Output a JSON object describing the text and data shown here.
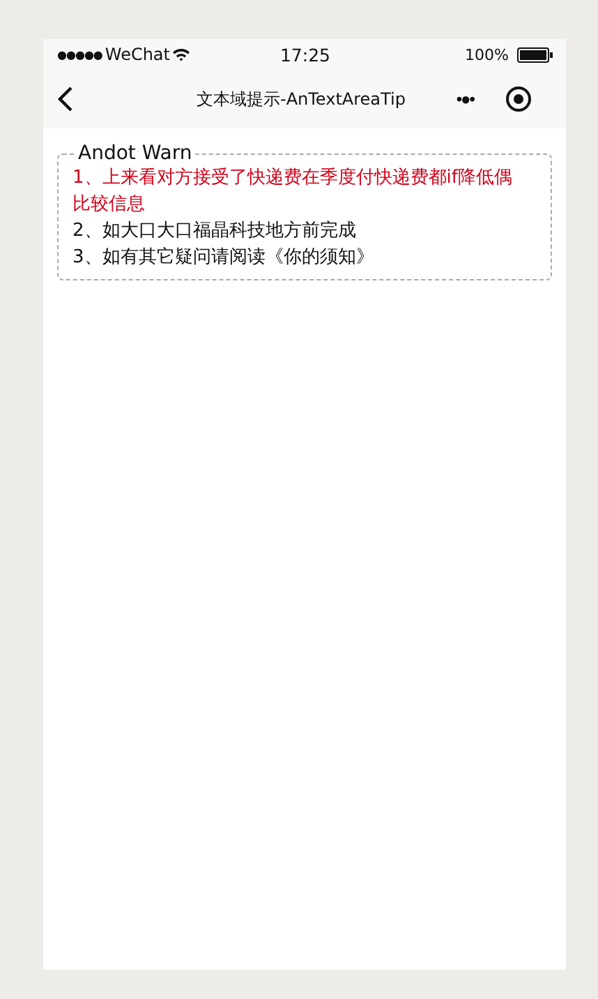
{
  "status_bar": {
    "signal": "●●●●●",
    "carrier": "WeChat",
    "time": "17:25",
    "battery_text": "100%"
  },
  "nav_bar": {
    "title": "文本域提示-AnTextAreaTip",
    "more": "•●•"
  },
  "warn_box": {
    "legend": "Andot Warn",
    "items": [
      {
        "text": "1、上来看对方接受了快递费在季度付快递费都if降低偶比较信息",
        "color": "#d0021b"
      },
      {
        "text": "2、如大口大口福晶科技地方前完成",
        "color": "#111111"
      },
      {
        "text": "3、如有其它疑问请阅读《你的须知》",
        "color": "#111111"
      }
    ]
  }
}
